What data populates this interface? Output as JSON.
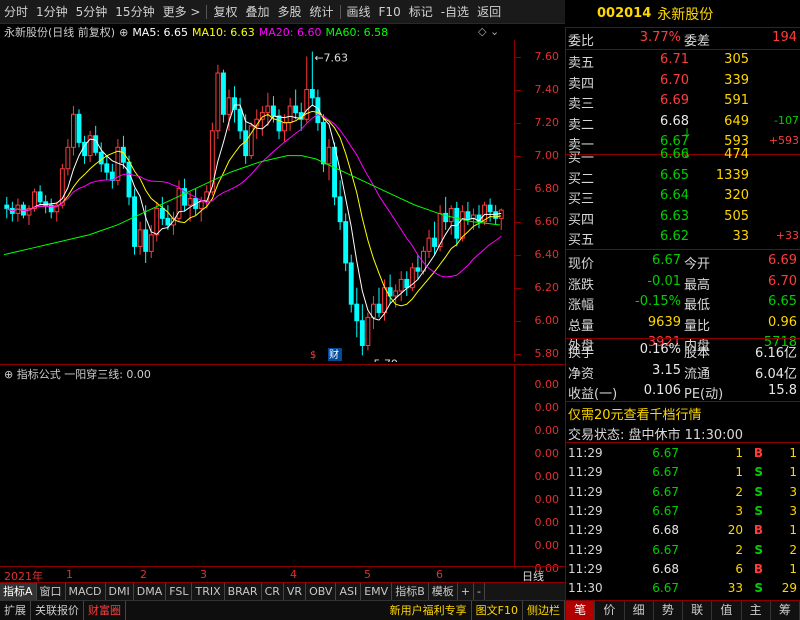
{
  "toolbar": {
    "items": [
      "分时",
      "1分钟",
      "5分钟",
      "15分钟",
      "更多 >",
      "复权",
      "叠加",
      "多股",
      "统计",
      "画线",
      "F10",
      "标记",
      "-自选",
      "返回"
    ]
  },
  "stock": {
    "code": "002014",
    "name": "永新股份"
  },
  "chart_info": {
    "title": "永新股份(日线 前复权)",
    "ma5": "MA5: 6.65",
    "ma10": "MA10: 6.63",
    "ma20": "MA20: 6.60",
    "ma60": "MA60: 6.58",
    "colors": {
      "ma5": "#ffffff",
      "ma10": "#ffff00",
      "ma20": "#ff00ff",
      "ma60": "#00ff00"
    }
  },
  "chart_data": {
    "type": "candlestick",
    "ylim": [
      5.75,
      7.7
    ],
    "yticks": [
      "7.60",
      "7.40",
      "7.20",
      "7.00",
      "6.80",
      "6.60",
      "6.40",
      "6.20",
      "6.00",
      "5.80"
    ],
    "annotations": {
      "high": "7.63",
      "low": "5.79"
    },
    "x_labels": [
      "2021年",
      "1",
      "2",
      "3",
      "4",
      "5",
      "6"
    ],
    "markers": [
      "$",
      "财"
    ],
    "candles": [
      [
        6.7,
        6.75,
        6.62,
        6.68
      ],
      [
        6.68,
        6.72,
        6.6,
        6.65
      ],
      [
        6.65,
        6.74,
        6.6,
        6.7
      ],
      [
        6.7,
        6.72,
        6.62,
        6.64
      ],
      [
        6.64,
        6.7,
        6.58,
        6.68
      ],
      [
        6.68,
        6.8,
        6.66,
        6.78
      ],
      [
        6.78,
        6.82,
        6.7,
        6.72
      ],
      [
        6.72,
        6.76,
        6.65,
        6.7
      ],
      [
        6.7,
        6.74,
        6.62,
        6.66
      ],
      [
        6.66,
        6.72,
        6.6,
        6.7
      ],
      [
        6.7,
        6.95,
        6.68,
        6.92
      ],
      [
        6.92,
        7.1,
        6.88,
        7.05
      ],
      [
        7.05,
        7.3,
        7.0,
        7.25
      ],
      [
        7.25,
        7.28,
        7.05,
        7.08
      ],
      [
        7.08,
        7.12,
        6.95,
        7.0
      ],
      [
        7.0,
        7.15,
        6.96,
        7.12
      ],
      [
        7.12,
        7.18,
        7.0,
        7.02
      ],
      [
        7.02,
        7.08,
        6.9,
        6.95
      ],
      [
        6.95,
        7.0,
        6.85,
        6.9
      ],
      [
        6.9,
        6.95,
        6.8,
        6.85
      ],
      [
        6.85,
        7.1,
        6.82,
        7.05
      ],
      [
        7.05,
        7.12,
        6.92,
        6.96
      ],
      [
        6.96,
        7.0,
        6.7,
        6.75
      ],
      [
        6.75,
        6.8,
        6.4,
        6.45
      ],
      [
        6.45,
        6.6,
        6.4,
        6.55
      ],
      [
        6.55,
        6.7,
        6.35,
        6.42
      ],
      [
        6.42,
        6.58,
        6.38,
        6.52
      ],
      [
        6.52,
        6.72,
        6.48,
        6.68
      ],
      [
        6.68,
        6.75,
        6.58,
        6.62
      ],
      [
        6.62,
        6.7,
        6.55,
        6.58
      ],
      [
        6.58,
        6.66,
        6.52,
        6.62
      ],
      [
        6.62,
        6.85,
        6.6,
        6.8
      ],
      [
        6.8,
        6.86,
        6.66,
        6.7
      ],
      [
        6.7,
        6.78,
        6.6,
        6.74
      ],
      [
        6.74,
        6.8,
        6.64,
        6.68
      ],
      [
        6.68,
        6.75,
        6.6,
        6.72
      ],
      [
        6.72,
        6.82,
        6.68,
        6.78
      ],
      [
        6.78,
        7.2,
        6.76,
        7.15
      ],
      [
        7.15,
        7.55,
        7.1,
        7.5
      ],
      [
        7.5,
        7.52,
        7.2,
        7.25
      ],
      [
        7.25,
        7.4,
        7.15,
        7.35
      ],
      [
        7.35,
        7.42,
        7.2,
        7.28
      ],
      [
        7.28,
        7.35,
        7.1,
        7.15
      ],
      [
        7.15,
        7.25,
        6.95,
        7.0
      ],
      [
        7.0,
        7.2,
        6.98,
        7.18
      ],
      [
        7.18,
        7.28,
        7.1,
        7.22
      ],
      [
        7.22,
        7.3,
        7.12,
        7.26
      ],
      [
        7.26,
        7.38,
        7.18,
        7.3
      ],
      [
        7.3,
        7.36,
        7.2,
        7.24
      ],
      [
        7.24,
        7.28,
        7.1,
        7.15
      ],
      [
        7.15,
        7.25,
        7.08,
        7.2
      ],
      [
        7.2,
        7.35,
        7.15,
        7.3
      ],
      [
        7.3,
        7.4,
        7.22,
        7.26
      ],
      [
        7.26,
        7.32,
        7.15,
        7.22
      ],
      [
        7.22,
        7.6,
        7.2,
        7.4
      ],
      [
        7.4,
        7.63,
        7.3,
        7.35
      ],
      [
        7.35,
        7.4,
        7.15,
        7.2
      ],
      [
        7.2,
        7.25,
        6.9,
        6.95
      ],
      [
        6.95,
        7.1,
        6.85,
        7.05
      ],
      [
        7.05,
        7.08,
        6.7,
        6.75
      ],
      [
        6.75,
        6.85,
        6.55,
        6.6
      ],
      [
        6.6,
        6.65,
        6.3,
        6.35
      ],
      [
        6.35,
        6.4,
        6.05,
        6.1
      ],
      [
        6.1,
        6.2,
        5.9,
        6.0
      ],
      [
        6.0,
        6.1,
        5.79,
        5.85
      ],
      [
        5.85,
        6.05,
        5.82,
        6.02
      ],
      [
        6.02,
        6.15,
        5.95,
        6.1
      ],
      [
        6.1,
        6.2,
        6.02,
        6.05
      ],
      [
        6.05,
        6.25,
        6.0,
        6.2
      ],
      [
        6.2,
        6.28,
        6.1,
        6.15
      ],
      [
        6.15,
        6.22,
        6.08,
        6.18
      ],
      [
        6.18,
        6.3,
        6.12,
        6.25
      ],
      [
        6.25,
        6.3,
        6.15,
        6.2
      ],
      [
        6.2,
        6.35,
        6.18,
        6.32
      ],
      [
        6.32,
        6.4,
        6.25,
        6.3
      ],
      [
        6.3,
        6.45,
        6.28,
        6.42
      ],
      [
        6.42,
        6.55,
        6.38,
        6.5
      ],
      [
        6.5,
        6.6,
        6.4,
        6.45
      ],
      [
        6.45,
        6.7,
        6.42,
        6.65
      ],
      [
        6.65,
        6.75,
        6.55,
        6.6
      ],
      [
        6.6,
        6.7,
        6.52,
        6.68
      ],
      [
        6.68,
        6.72,
        6.45,
        6.5
      ],
      [
        6.5,
        6.7,
        6.48,
        6.66
      ],
      [
        6.66,
        6.72,
        6.58,
        6.62
      ],
      [
        6.62,
        6.68,
        6.55,
        6.64
      ],
      [
        6.64,
        6.7,
        6.56,
        6.6
      ],
      [
        6.6,
        6.72,
        6.58,
        6.7
      ],
      [
        6.7,
        6.74,
        6.6,
        6.66
      ],
      [
        6.66,
        6.7,
        6.58,
        6.62
      ],
      [
        6.62,
        6.68,
        6.55,
        6.67
      ]
    ],
    "ma60": [
      6.4,
      6.42,
      6.44,
      6.46,
      6.48,
      6.5,
      6.52,
      6.55,
      6.58,
      6.62,
      6.66,
      6.7,
      6.74,
      6.78,
      6.82,
      6.86,
      6.9,
      6.93,
      6.96,
      6.98,
      7.0,
      7.0,
      6.98,
      6.94,
      6.9,
      6.86,
      6.82,
      6.78,
      6.74,
      6.7,
      6.67,
      6.64,
      6.62,
      6.6,
      6.59,
      6.58
    ]
  },
  "sub_chart": {
    "title": "指标公式",
    "formula": "一阳穿三线: 0.00",
    "yticks": [
      "0.00",
      "0.00",
      "0.00",
      "0.00",
      "0.00",
      "0.00",
      "0.00",
      "0.00",
      "0.00"
    ]
  },
  "tabs": [
    "指标A",
    "窗口",
    "MACD",
    "DMI",
    "DMA",
    "FSL",
    "TRIX",
    "BRAR",
    "CR",
    "VR",
    "OBV",
    "ASI",
    "EMV",
    "指标B",
    "模板",
    "+",
    "-"
  ],
  "period_label": "日线",
  "status": [
    "扩展",
    "关联报价",
    "财富圈",
    "新用户福利专享",
    "图文F10",
    "侧边栏"
  ],
  "quote": {
    "weibi_label": "委比",
    "weibi": "3.77%",
    "weicha_label": "委差",
    "weicha": "194",
    "asks": [
      {
        "label": "卖五",
        "price": "6.71",
        "vol": "305",
        "chg": ""
      },
      {
        "label": "卖四",
        "price": "6.70",
        "vol": "339",
        "chg": ""
      },
      {
        "label": "卖三",
        "price": "6.69",
        "vol": "591",
        "chg": ""
      },
      {
        "label": "卖二",
        "price": "6.68",
        "vol": "649",
        "chg": "-107"
      },
      {
        "label": "卖一",
        "price": "6.67",
        "vol": "593",
        "chg": "+593"
      }
    ],
    "bids": [
      {
        "label": "买一",
        "price": "6.66",
        "vol": "474",
        "chg": ""
      },
      {
        "label": "买二",
        "price": "6.65",
        "vol": "1339",
        "chg": ""
      },
      {
        "label": "买三",
        "price": "6.64",
        "vol": "320",
        "chg": ""
      },
      {
        "label": "买四",
        "price": "6.63",
        "vol": "505",
        "chg": ""
      },
      {
        "label": "买五",
        "price": "6.62",
        "vol": "33",
        "chg": "+33"
      }
    ],
    "stats": [
      {
        "l1": "现价",
        "v1": "6.67",
        "c1": "green",
        "l2": "今开",
        "v2": "6.69",
        "c2": "red"
      },
      {
        "l1": "涨跌",
        "v1": "-0.01",
        "c1": "green",
        "l2": "最高",
        "v2": "6.70",
        "c2": "red"
      },
      {
        "l1": "涨幅",
        "v1": "-0.15%",
        "c1": "green",
        "l2": "最低",
        "v2": "6.65",
        "c2": "green"
      },
      {
        "l1": "总量",
        "v1": "9639",
        "c1": "yellow",
        "l2": "量比",
        "v2": "0.96",
        "c2": "yellow"
      },
      {
        "l1": "外盘",
        "v1": "3921",
        "c1": "red",
        "l2": "内盘",
        "v2": "5718",
        "c2": "green"
      }
    ],
    "fund": [
      {
        "l1": "换手",
        "v1": "0.16%",
        "l2": "股本",
        "v2": "6.16亿"
      },
      {
        "l1": "净资",
        "v1": "3.15",
        "l2": "流通",
        "v2": "6.04亿"
      },
      {
        "l1": "收益(一)",
        "v1": "0.106",
        "l2": "PE(动)",
        "v2": "15.8"
      }
    ],
    "promo": "仅需20元查看千档行情",
    "trade_status": "交易状态: 盘中休市 11:30:00"
  },
  "ticks": [
    {
      "t": "11:29",
      "p": "6.67",
      "pc": "green",
      "v": "1",
      "s": "B",
      "sc": "red",
      "n": "1"
    },
    {
      "t": "11:29",
      "p": "6.67",
      "pc": "green",
      "v": "1",
      "s": "S",
      "sc": "green",
      "n": "1"
    },
    {
      "t": "11:29",
      "p": "6.67",
      "pc": "green",
      "v": "2",
      "s": "S",
      "sc": "green",
      "n": "3"
    },
    {
      "t": "11:29",
      "p": "6.67",
      "pc": "green",
      "v": "3",
      "s": "S",
      "sc": "green",
      "n": "3"
    },
    {
      "t": "11:29",
      "p": "6.68",
      "pc": "white",
      "v": "20",
      "s": "B",
      "sc": "red",
      "n": "1"
    },
    {
      "t": "11:29",
      "p": "6.67",
      "pc": "green",
      "v": "2",
      "s": "S",
      "sc": "green",
      "n": "2"
    },
    {
      "t": "11:29",
      "p": "6.68",
      "pc": "white",
      "v": "6",
      "s": "B",
      "sc": "red",
      "n": "1"
    },
    {
      "t": "11:30",
      "p": "6.67",
      "pc": "green",
      "v": "33",
      "s": "S",
      "sc": "green",
      "n": "29"
    }
  ],
  "bottom_tabs": [
    "笔",
    "价",
    "细",
    "势",
    "联",
    "值",
    "主",
    "筹"
  ]
}
